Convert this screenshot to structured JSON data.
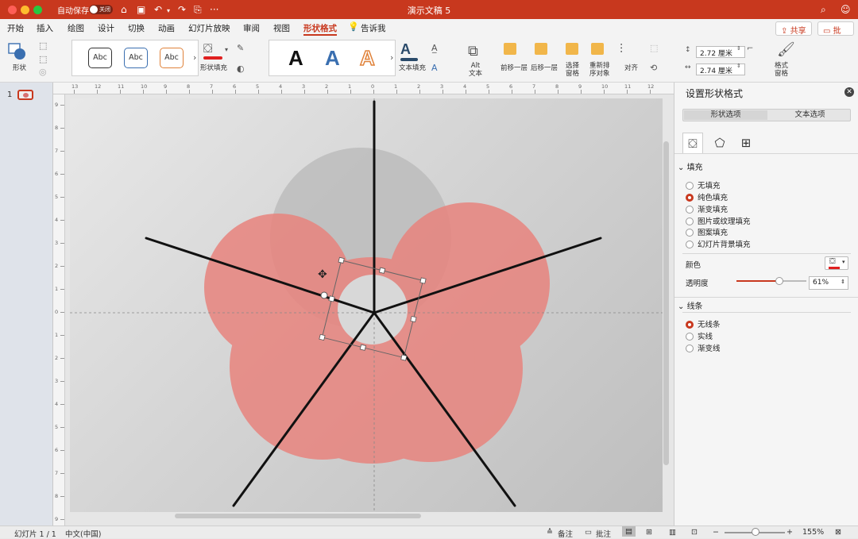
{
  "window": {
    "title": "演示文稿 5",
    "autosave_label": "自动保存",
    "autosave_state": "关闭"
  },
  "tabs": [
    "开始",
    "插入",
    "绘图",
    "设计",
    "切换",
    "动画",
    "幻灯片放映",
    "审阅",
    "视图",
    "形状格式",
    "告诉我"
  ],
  "active_tab": "形状格式",
  "header_buttons": {
    "share": "共享",
    "comment": "批注"
  },
  "ribbon": {
    "shape_label": "形状",
    "style_samples": [
      "Abc",
      "Abc",
      "Abc"
    ],
    "shape_fill_label": "形状填充",
    "wordart_samples": [
      "A",
      "A",
      "A"
    ],
    "text_fill_label": "文本填充",
    "alt_text_label": "Alt\n文本",
    "bring_forward_label": "前移一层",
    "send_backward_label": "后移一层",
    "selection_pane_label": "选择\n窗格",
    "reorder_label": "重新排\n序对象",
    "align_label": "对齐",
    "width_value": "2.72 厘米",
    "height_value": "2.74 厘米",
    "format_pane_label": "格式\n窗格",
    "colors": {
      "fill_swatch": "#e02020",
      "text_fill_swatch": "#2a4a6a"
    }
  },
  "thumbnails": {
    "slide_number": "1"
  },
  "format_pane": {
    "title": "设置形状格式",
    "segments": [
      "形状选项",
      "文本选项"
    ],
    "fill_section": "填充",
    "fill_options": [
      "无填充",
      "纯色填充",
      "渐变填充",
      "图片或纹理填充",
      "图案填充",
      "幻灯片背景填充"
    ],
    "fill_selected": 1,
    "color_label": "颜色",
    "transparency_label": "透明度",
    "transparency_value": "61%",
    "transparency_fraction": 0.61,
    "line_section": "线条",
    "line_options": [
      "无线条",
      "实线",
      "渐变线"
    ],
    "line_selected": 0
  },
  "status_bar": {
    "slide_info": "幻灯片 1 / 1",
    "language": "中文(中国)",
    "notes": "备注",
    "comments": "批注",
    "zoom": "155%"
  },
  "slide_colors": {
    "petal": "#e8847e",
    "gray_circle": "#bcbcbc",
    "line": "#111111"
  }
}
